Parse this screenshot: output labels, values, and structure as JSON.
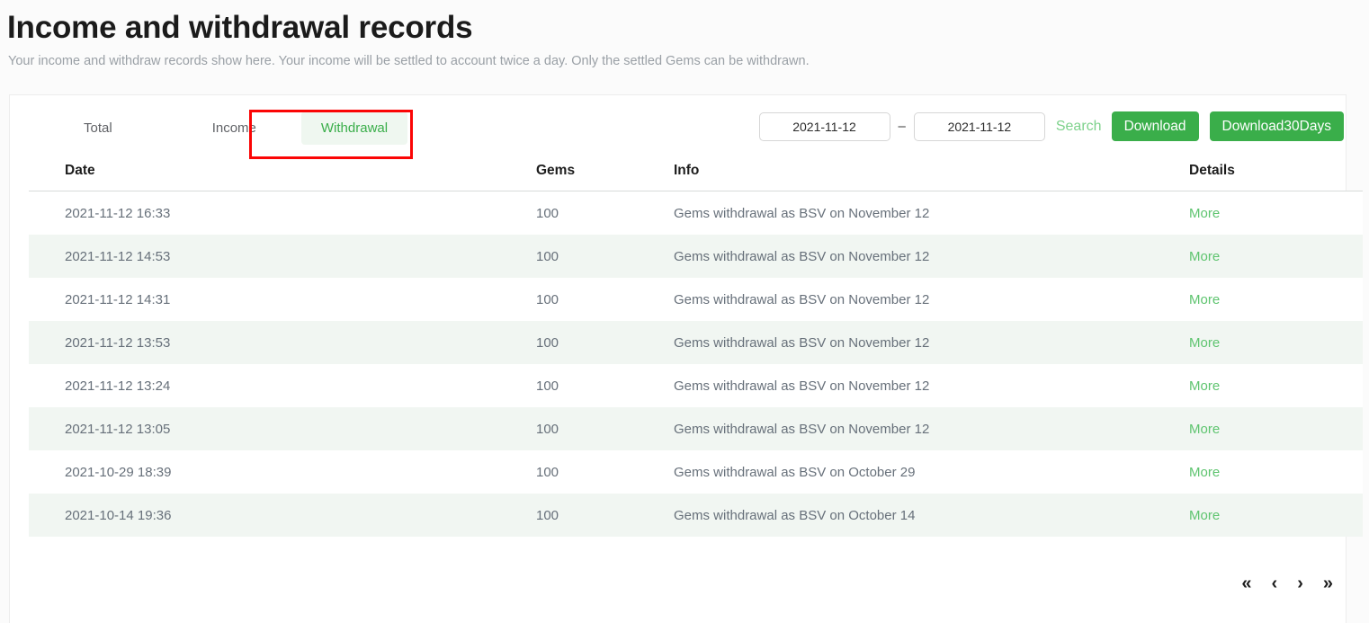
{
  "header": {
    "title": "Income and withdrawal records",
    "subtitle": "Your income and withdraw records show here. Your income will be settled to account twice a day. Only the settled Gems can be withdrawn."
  },
  "toolbar": {
    "tabs": [
      {
        "label": "Total",
        "active": false
      },
      {
        "label": "Income",
        "active": false
      },
      {
        "label": "Withdrawal",
        "active": true
      }
    ],
    "date_from": {
      "value": "2021-11-12",
      "placeholder": "2021-11-12"
    },
    "date_separator": "–",
    "date_to": {
      "value": "2021-11-12",
      "placeholder": "2021-11-12"
    },
    "search_label": "Search",
    "download_label": "Download",
    "download30_label": "Download30Days"
  },
  "table": {
    "columns": [
      "Date",
      "Gems",
      "Info",
      "Details"
    ],
    "rows": [
      {
        "date": "2021-11-12 16:33",
        "gems": "100",
        "info": "Gems withdrawal as BSV on November 12",
        "details": "More"
      },
      {
        "date": "2021-11-12 14:53",
        "gems": "100",
        "info": "Gems withdrawal as BSV on November 12",
        "details": "More"
      },
      {
        "date": "2021-11-12 14:31",
        "gems": "100",
        "info": "Gems withdrawal as BSV on November 12",
        "details": "More"
      },
      {
        "date": "2021-11-12 13:53",
        "gems": "100",
        "info": "Gems withdrawal as BSV on November 12",
        "details": "More"
      },
      {
        "date": "2021-11-12 13:24",
        "gems": "100",
        "info": "Gems withdrawal as BSV on November 12",
        "details": "More"
      },
      {
        "date": "2021-11-12 13:05",
        "gems": "100",
        "info": "Gems withdrawal as BSV on November 12",
        "details": "More"
      },
      {
        "date": "2021-10-29 18:39",
        "gems": "100",
        "info": "Gems withdrawal as BSV on October 29",
        "details": "More"
      },
      {
        "date": "2021-10-14 19:36",
        "gems": "100",
        "info": "Gems withdrawal as BSV on October 14",
        "details": "More"
      }
    ]
  },
  "pagination": {
    "first": "«",
    "prev": "‹",
    "next": "›",
    "last": "»"
  },
  "colors": {
    "brand_green": "#3aae4a",
    "link_green": "#5ec46f",
    "tab_active_bg": "#eff7f0",
    "row_stripe": "#f1f6f2",
    "annotation_red": "#fb0505"
  }
}
